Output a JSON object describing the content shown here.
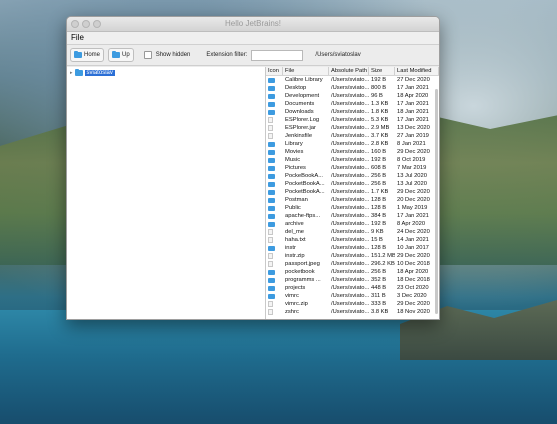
{
  "window": {
    "title": "Hello JetBrains!"
  },
  "menu": {
    "file": "File"
  },
  "toolbar": {
    "home_label": "Home",
    "up_label": "Up",
    "show_hidden_label": "Show hidden",
    "extension_filter_label": "Extension filter:",
    "extension_filter_value": "",
    "current_path": "/Users/sviatoslav"
  },
  "tree": {
    "root_label": "sviatoslav"
  },
  "table": {
    "headers": [
      "Icon",
      "File",
      "Absolute Path",
      "Size",
      "Last Modified"
    ],
    "rows": [
      {
        "icon": "folder",
        "name": "Calibre Library",
        "path": "/Users/sviato...",
        "size": "192 B",
        "modified": "27 Dec 2020"
      },
      {
        "icon": "folder",
        "name": "Desktop",
        "path": "/Users/sviato...",
        "size": "800 B",
        "modified": "17 Jan 2021"
      },
      {
        "icon": "folder",
        "name": "Development",
        "path": "/Users/sviato...",
        "size": "96 B",
        "modified": "18 Apr 2020"
      },
      {
        "icon": "folder",
        "name": "Documents",
        "path": "/Users/sviato...",
        "size": "1.3 KB",
        "modified": "17 Jan 2021"
      },
      {
        "icon": "folder",
        "name": "Downloads",
        "path": "/Users/sviato...",
        "size": "1.8 KB",
        "modified": "18 Jan 2021"
      },
      {
        "icon": "file",
        "name": "ESPlorer.Log",
        "path": "/Users/sviato...",
        "size": "5.3 KB",
        "modified": "17 Jan 2021"
      },
      {
        "icon": "file",
        "name": "ESPlorer.jar",
        "path": "/Users/sviato...",
        "size": "2.9 MB",
        "modified": "13 Dec 2020"
      },
      {
        "icon": "file",
        "name": "Jenkinsfile",
        "path": "/Users/sviato...",
        "size": "3.7 KB",
        "modified": "27 Jan 2019"
      },
      {
        "icon": "folder",
        "name": "Library",
        "path": "/Users/sviato...",
        "size": "2.8 KB",
        "modified": "8 Jan 2021"
      },
      {
        "icon": "folder",
        "name": "Movies",
        "path": "/Users/sviato...",
        "size": "160 B",
        "modified": "29 Dec 2020"
      },
      {
        "icon": "folder",
        "name": "Music",
        "path": "/Users/sviato...",
        "size": "192 B",
        "modified": "8 Oct 2019"
      },
      {
        "icon": "folder",
        "name": "Pictures",
        "path": "/Users/sviato...",
        "size": "608 B",
        "modified": "7 Mar 2019"
      },
      {
        "icon": "folder",
        "name": "PockeBookA...",
        "path": "/Users/sviato...",
        "size": "256 B",
        "modified": "13 Jul 2020"
      },
      {
        "icon": "folder",
        "name": "PocketBookA...",
        "path": "/Users/sviato...",
        "size": "256 B",
        "modified": "13 Jul 2020"
      },
      {
        "icon": "folder",
        "name": "PocketBookA...",
        "path": "/Users/sviato...",
        "size": "1.7 KB",
        "modified": "29 Dec 2020"
      },
      {
        "icon": "folder",
        "name": "Postman",
        "path": "/Users/sviato...",
        "size": "128 B",
        "modified": "20 Dec 2020"
      },
      {
        "icon": "folder",
        "name": "Public",
        "path": "/Users/sviato...",
        "size": "128 B",
        "modified": "1 May 2019"
      },
      {
        "icon": "folder",
        "name": "apache-ftps...",
        "path": "/Users/sviato...",
        "size": "384 B",
        "modified": "17 Jan 2021"
      },
      {
        "icon": "folder",
        "name": "archive",
        "path": "/Users/sviato...",
        "size": "192 B",
        "modified": "8 Apr 2020"
      },
      {
        "icon": "file",
        "name": "del_me",
        "path": "/Users/sviato...",
        "size": "9 KB",
        "modified": "24 Dec 2020"
      },
      {
        "icon": "file",
        "name": "haha.txt",
        "path": "/Users/sviato...",
        "size": "15 B",
        "modified": "14 Jan 2021"
      },
      {
        "icon": "folder",
        "name": "instr",
        "path": "/Users/sviato...",
        "size": "128 B",
        "modified": "10 Jan 2017"
      },
      {
        "icon": "file",
        "name": "instr.zip",
        "path": "/Users/sviato...",
        "size": "151.2 MB",
        "modified": "29 Dec 2020"
      },
      {
        "icon": "file",
        "name": "passport.jpeg",
        "path": "/Users/sviato...",
        "size": "296.2 KB",
        "modified": "10 Dec 2018"
      },
      {
        "icon": "folder",
        "name": "pocketbook",
        "path": "/Users/sviato...",
        "size": "256 B",
        "modified": "18 Apr 2020"
      },
      {
        "icon": "folder",
        "name": "programms ...",
        "path": "/Users/sviato...",
        "size": "352 B",
        "modified": "18 Dec 2018"
      },
      {
        "icon": "folder",
        "name": "projects",
        "path": "/Users/sviato...",
        "size": "448 B",
        "modified": "23 Oct 2020"
      },
      {
        "icon": "folder",
        "name": "vimrc",
        "path": "/Users/sviato...",
        "size": "311 B",
        "modified": "3 Dec 2020"
      },
      {
        "icon": "file",
        "name": "vimrc.zip",
        "path": "/Users/sviato...",
        "size": "333 B",
        "modified": "29 Dec 2020"
      },
      {
        "icon": "file",
        "name": "zshrc",
        "path": "/Users/sviato...",
        "size": "3.8 KB",
        "modified": "18 Nov 2020"
      }
    ]
  }
}
